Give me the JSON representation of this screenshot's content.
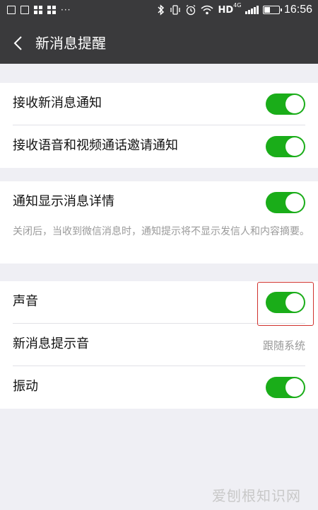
{
  "statusbar": {
    "network": "HD",
    "network_sub": "4G",
    "battery_level": 0.4,
    "time": "16:56"
  },
  "nav": {
    "back_icon": "chevron-left-icon",
    "title": "新消息提醒"
  },
  "group1": {
    "items": [
      {
        "label": "接收新消息通知",
        "toggle_on": true
      },
      {
        "label": "接收语音和视频通话邀请通知",
        "toggle_on": true
      }
    ]
  },
  "group2": {
    "items": [
      {
        "label": "通知显示消息详情",
        "toggle_on": true
      }
    ],
    "hint": "关闭后，当收到微信消息时，通知提示将不显示发信人和内容摘要。"
  },
  "group3": {
    "items": [
      {
        "label": "声音",
        "toggle_on": true
      },
      {
        "label": "新消息提示音",
        "value": "跟随系统"
      },
      {
        "label": "振动",
        "toggle_on": true
      }
    ]
  },
  "colors": {
    "toggle_on": "#1aad19",
    "header_bg": "#3a3a3c",
    "page_bg": "#efeff4",
    "highlight": "#d0312d"
  },
  "watermark": "爱刨根知识网"
}
